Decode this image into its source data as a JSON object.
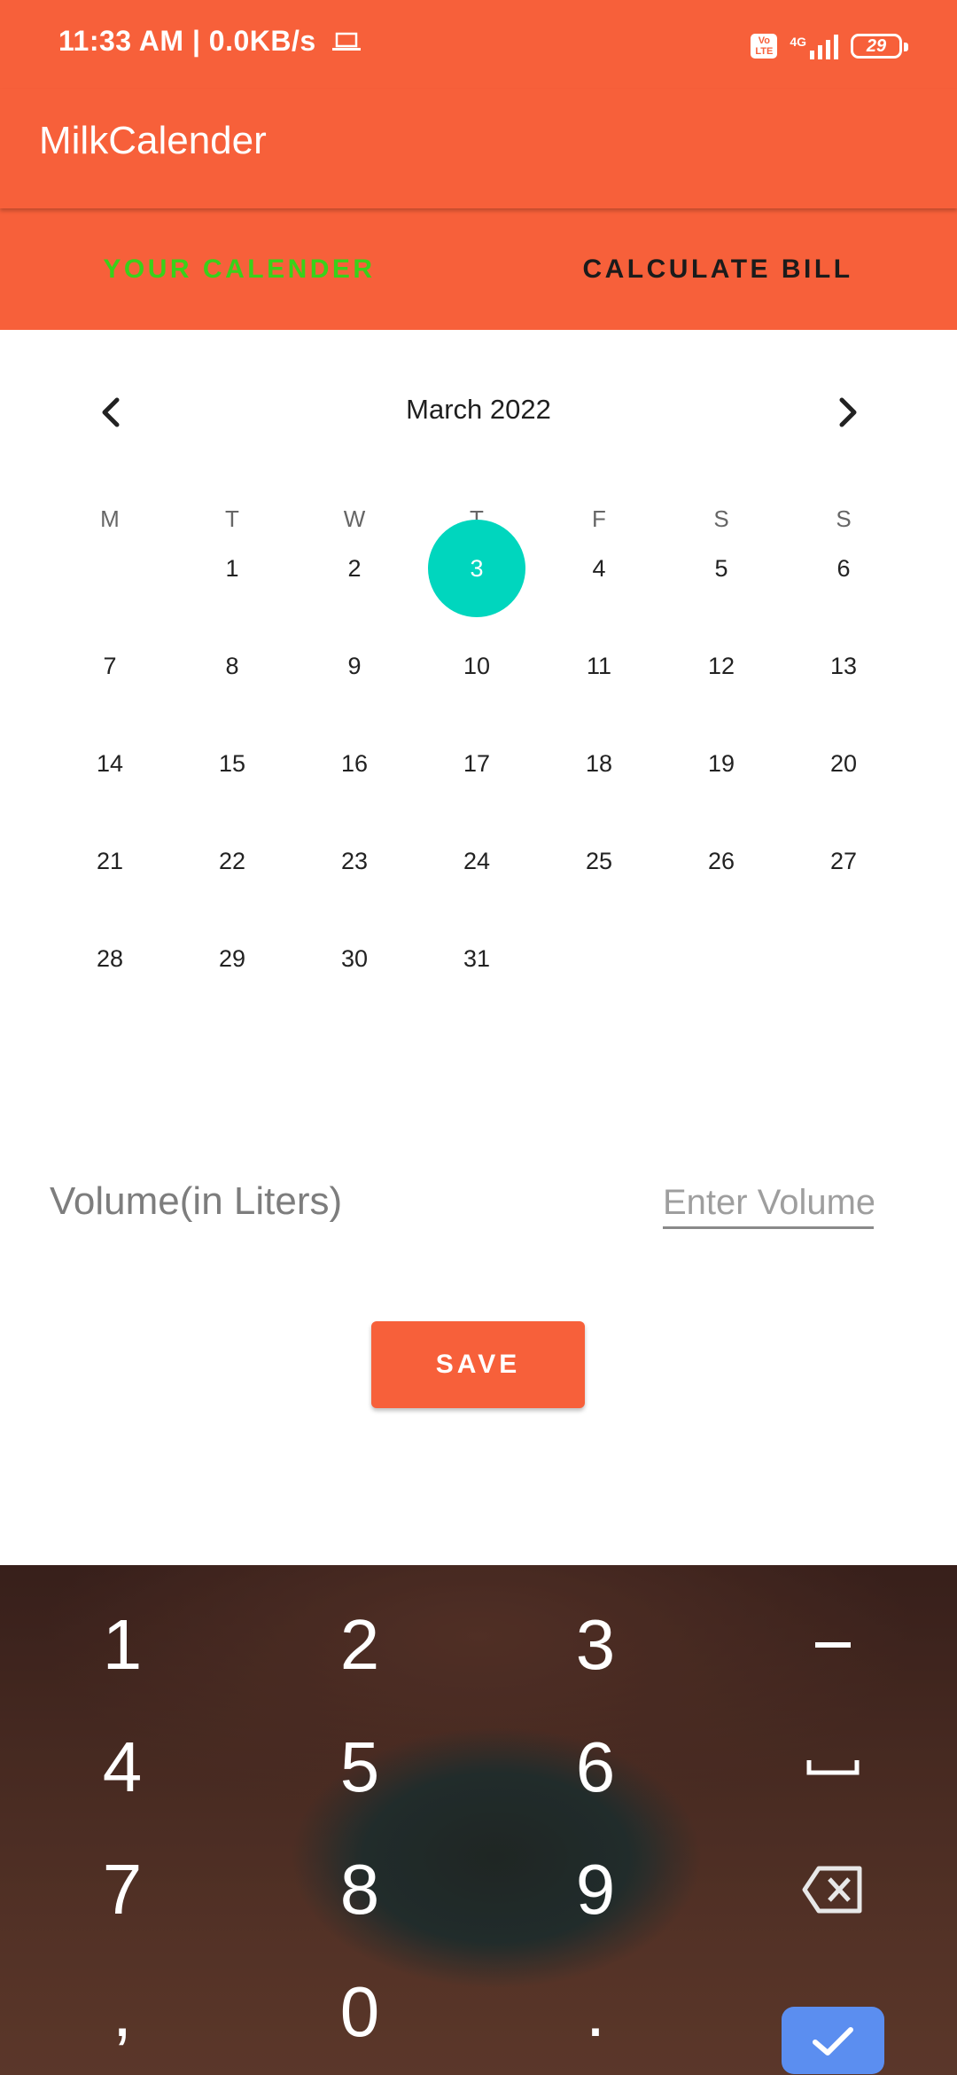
{
  "status_bar": {
    "time": "11:33 AM",
    "network_speed": "0.0KB/s",
    "volte_badge": "Vo LTE",
    "network_type": "4G",
    "battery": "29",
    "icons": [
      "laptop-icon",
      "volte-icon",
      "signal-icon",
      "battery-icon"
    ]
  },
  "app_bar": {
    "title": "MilkCalender"
  },
  "tabs": [
    {
      "label": "YOUR CALENDER",
      "active": true
    },
    {
      "label": "CALCULATE BILL",
      "active": false
    }
  ],
  "calendar": {
    "month_label": "March 2022",
    "weekdays": [
      "M",
      "T",
      "W",
      "T",
      "F",
      "S",
      "S"
    ],
    "weeks": [
      [
        "",
        "1",
        "2",
        "3",
        "4",
        "5",
        "6"
      ],
      [
        "7",
        "8",
        "9",
        "10",
        "11",
        "12",
        "13"
      ],
      [
        "14",
        "15",
        "16",
        "17",
        "18",
        "19",
        "20"
      ],
      [
        "21",
        "22",
        "23",
        "24",
        "25",
        "26",
        "27"
      ],
      [
        "28",
        "29",
        "30",
        "31",
        "",
        "",
        ""
      ]
    ],
    "selected_day": "3",
    "selected_color": "#00D6BE"
  },
  "volume": {
    "label": "Volume(in Liters)",
    "placeholder": "Enter Volume",
    "value": ""
  },
  "save_button": {
    "label": "SAVE"
  },
  "keyboard": {
    "rows": [
      [
        "1",
        "2",
        "3",
        "–"
      ],
      [
        "4",
        "5",
        "6",
        "␣"
      ],
      [
        "7",
        "8",
        "9",
        "⌫"
      ],
      [
        ",",
        "0",
        ".",
        "✓"
      ]
    ]
  },
  "colors": {
    "primary": "#F7603A",
    "active_tab": "#39D11A",
    "accent": "#00D6BE",
    "keyboard_ok": "#5B8EF0"
  }
}
